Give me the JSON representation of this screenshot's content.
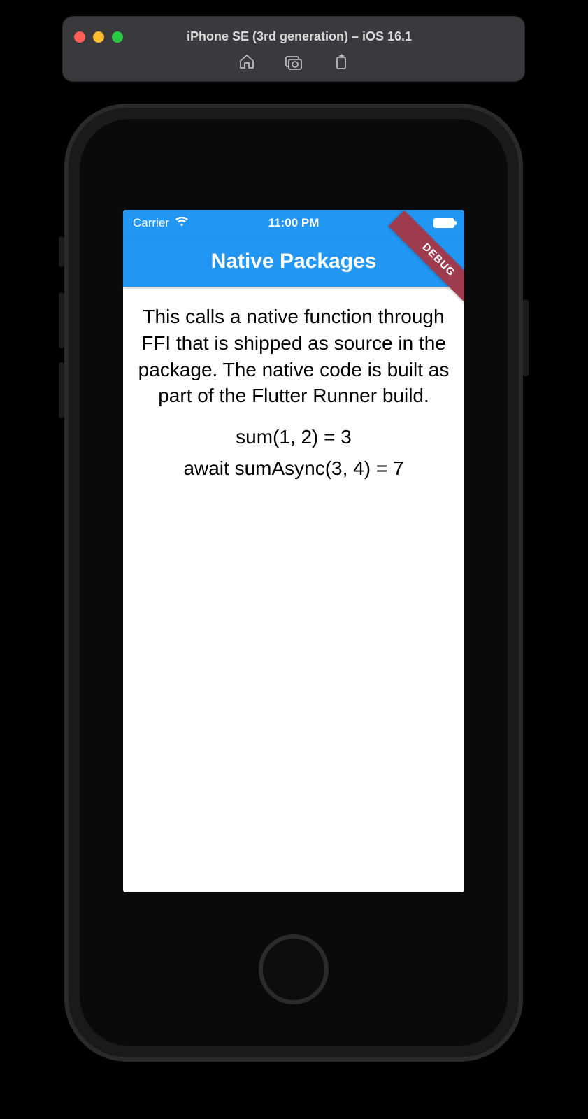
{
  "simulator": {
    "window_title": "iPhone SE (3rd generation) – iOS 16.1",
    "toolbar_icons": {
      "home": "home-icon",
      "screenshot": "screenshot-icon",
      "rotate": "rotate-icon"
    }
  },
  "statusbar": {
    "carrier": "Carrier",
    "time": "11:00 PM"
  },
  "appbar": {
    "title": "Native Packages"
  },
  "debug_banner": "DEBUG",
  "body": {
    "description": "This calls a native function through FFI that is shipped as source in the package. The native code is built as part of the Flutter Runner build.",
    "result_sum": "sum(1, 2) = 3",
    "result_sum_async": "await sumAsync(3, 4) = 7"
  },
  "colors": {
    "primary": "#2196f3",
    "debug_banner": "#9e3b4f"
  }
}
